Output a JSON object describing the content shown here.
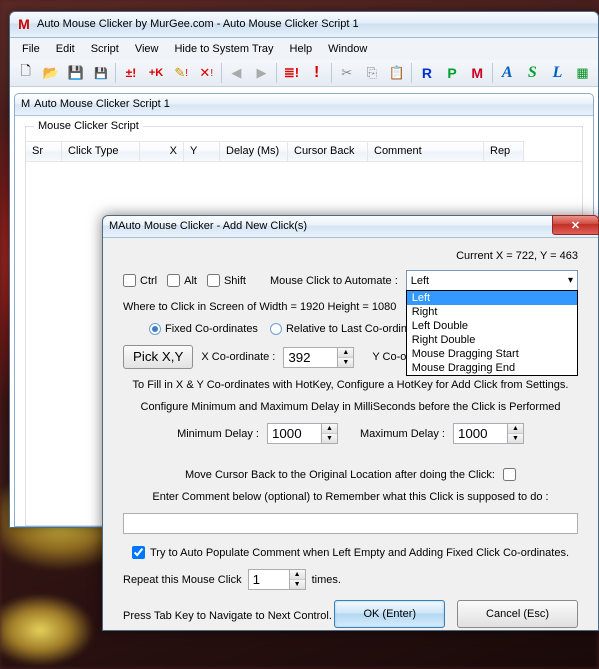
{
  "main_window": {
    "title": "Auto Mouse Clicker by MurGee.com - Auto Mouse Clicker Script 1"
  },
  "menubar": [
    "File",
    "Edit",
    "Script",
    "View",
    "Hide to System Tray",
    "Help",
    "Window"
  ],
  "doc_window": {
    "title": "Auto Mouse Clicker Script 1",
    "groupbox": "Mouse Clicker Script",
    "columns": [
      "Sr",
      "Click Type",
      "X",
      "Y",
      "Delay (Ms)",
      "Cursor Back",
      "Comment",
      "Rep"
    ]
  },
  "dialog": {
    "title": "Auto Mouse Clicker - Add New Click(s)",
    "current_xy": "Current X = 722, Y = 463",
    "ctrl": "Ctrl",
    "alt": "Alt",
    "shift": "Shift",
    "click_automate_label": "Mouse Click to Automate :",
    "click_type_selected": "Left",
    "click_type_options": [
      "Left",
      "Right",
      "Left Double",
      "Right Double",
      "Mouse Dragging Start",
      "Mouse Dragging End"
    ],
    "where_row": "Where to Click in Screen of Width = 1920 Height = 1080",
    "fixed_coords": "Fixed Co-ordinates",
    "relative": "Relative to Last Co-ordinates",
    "pick_btn": "Pick X,Y",
    "xcoord_label": "X Co-ordinate :",
    "xcoord_value": "392",
    "ycoord_label": "Y Co-ordin",
    "hotkey_hint": "To Fill in X & Y Co-ordinates with HotKey, Configure a HotKey for Add Click from Settings.",
    "delay_hint": "Configure Minimum and Maximum Delay in MilliSeconds before the Click is Performed",
    "min_delay_label": "Minimum Delay :",
    "min_delay_value": "1000",
    "max_delay_label": "Maximum Delay :",
    "max_delay_value": "1000",
    "cursor_back": "Move Cursor Back to the Original Location after doing the Click:",
    "comment_label": "Enter Comment below (optional) to Remember what this Click is supposed to do :",
    "auto_populate": "Try to Auto Populate Comment when Left Empty and Adding Fixed Click Co-ordinates.",
    "repeat_label": "Repeat this Mouse Click",
    "repeat_value": "1",
    "repeat_times": "times.",
    "ok": "OK (Enter)",
    "cancel": "Cancel (Esc)",
    "tab_hint": "Press Tab Key to Navigate to Next Control."
  }
}
